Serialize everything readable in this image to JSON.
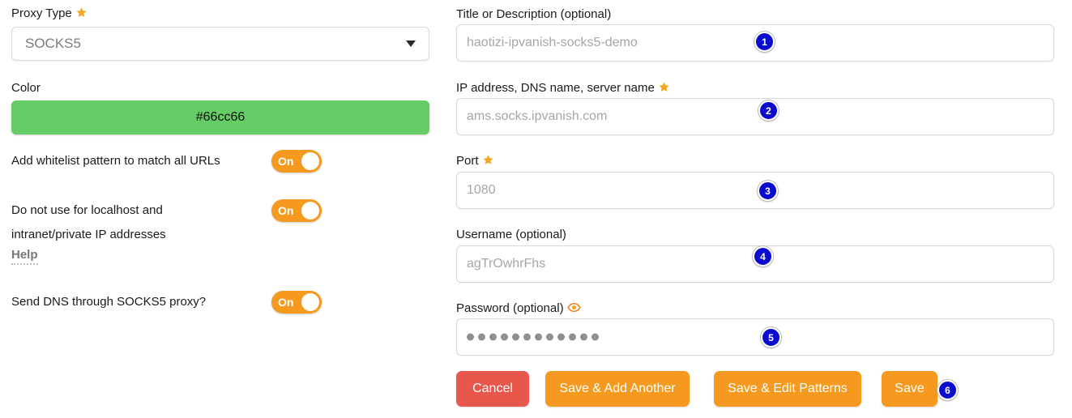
{
  "left": {
    "proxy_type": {
      "label": "Proxy Type",
      "required_icon": "star-icon",
      "value": "SOCKS5",
      "caret_icon": "chevron-down-icon"
    },
    "color": {
      "label": "Color",
      "value": "#66cc66",
      "swatch_hex": "#66cc66"
    },
    "toggles": [
      {
        "label": "Add whitelist pattern to match all URLs",
        "state": "On"
      },
      {
        "label_line1": "Do not use for localhost and",
        "label_line2": "intranet/private IP addresses",
        "state": "On"
      },
      {
        "label": "Send DNS through SOCKS5 proxy?",
        "state": "On"
      }
    ],
    "help_label": "Help"
  },
  "right": {
    "title_field": {
      "label": "Title or Description (optional)",
      "placeholder": "haotizi-ipvanish-socks5-demo",
      "badge": "1"
    },
    "host_field": {
      "label": "IP address, DNS name, server name",
      "required_icon": "star-icon",
      "placeholder": "ams.socks.ipvanish.com",
      "badge": "2"
    },
    "port_field": {
      "label": "Port",
      "required_icon": "star-icon",
      "placeholder": "1080",
      "badge": "3"
    },
    "username_field": {
      "label": "Username (optional)",
      "placeholder": "agTrOwhrFhs",
      "badge": "4"
    },
    "password_field": {
      "label": "Password (optional)",
      "reveal_icon": "eye-icon",
      "masked_length": 12,
      "badge": "5"
    },
    "buttons": {
      "cancel": "Cancel",
      "save_add_another": "Save & Add Another",
      "save_edit_patterns": "Save & Edit Patterns",
      "save": "Save",
      "save_badge": "6"
    }
  },
  "colors": {
    "accent_orange": "#f59a1e",
    "cancel_red": "#e8574c",
    "swatch_green": "#66cc66",
    "badge_blue": "#0c0ccc",
    "star_orange": "#f5a623"
  }
}
